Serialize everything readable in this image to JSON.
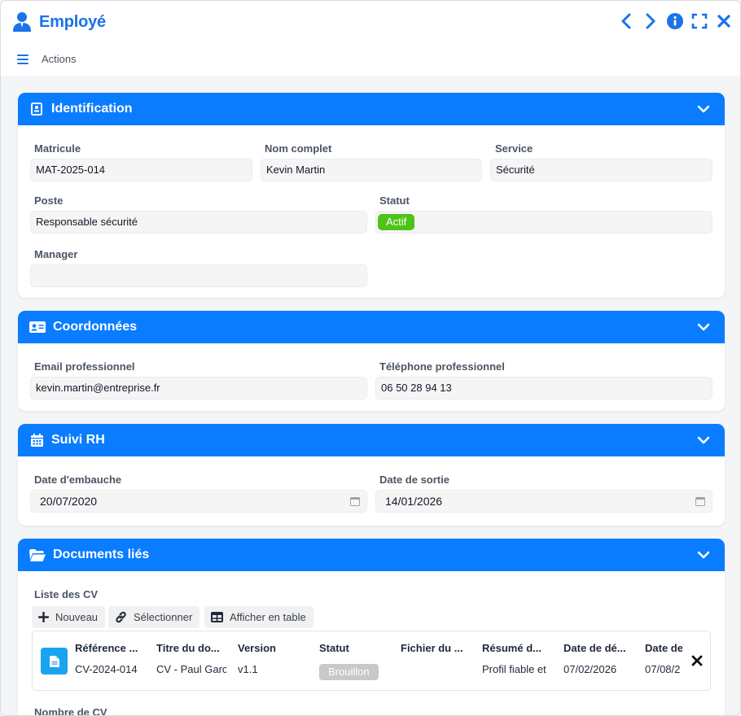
{
  "header": {
    "title": "Employé",
    "actions_label": "Actions",
    "icons": [
      "user-icon",
      "chevron-left-icon",
      "chevron-right-icon",
      "info-icon",
      "fullscreen-icon",
      "close-icon"
    ]
  },
  "colors": {
    "accent": "#0a7cff",
    "title": "#1a73e8",
    "active": "#4cc417",
    "draft": "#c8c8c8",
    "doc": "#1aa3ef"
  },
  "identification": {
    "title": "Identification",
    "matricule_label": "Matricule",
    "matricule": "MAT-2025-014",
    "nom_label": "Nom complet",
    "nom": "Kevin Martin",
    "service_label": "Service",
    "service": "Sécurité",
    "poste_label": "Poste",
    "poste": "Responsable sécurité",
    "statut_label": "Statut",
    "statut": "Actif",
    "manager_label": "Manager",
    "manager": ""
  },
  "coordonnees": {
    "title": "Coordonnées",
    "email_label": "Email professionnel",
    "email": "kevin.martin@entreprise.fr",
    "tel_label": "Téléphone professionnel",
    "tel": "06 50 28 94 13"
  },
  "suivi": {
    "title": "Suivi RH",
    "embauche_label": "Date d'embauche",
    "embauche": "20/07/2020",
    "sortie_label": "Date de sortie",
    "sortie": "14/01/2026"
  },
  "documents": {
    "title": "Documents liés",
    "cv_list_label": "Liste des CV",
    "toolbar": {
      "new": "Nouveau",
      "select": "Sélectionner",
      "table": "Afficher en table"
    },
    "columns": [
      "Référence ...",
      "Titre du do...",
      "Version",
      "Statut",
      "Fichier du ...",
      "Résumé d...",
      "Date de dé...",
      "Date de"
    ],
    "row": {
      "reference": "CV-2024-014",
      "titre": "CV - Paul Garc",
      "version": "v1.1",
      "statut": "Brouillon",
      "fichier": "",
      "resume": "Profil fiable et",
      "date_debut": "07/02/2026",
      "date_fin": "07/08/2"
    },
    "count_label": "Nombre de CV"
  }
}
